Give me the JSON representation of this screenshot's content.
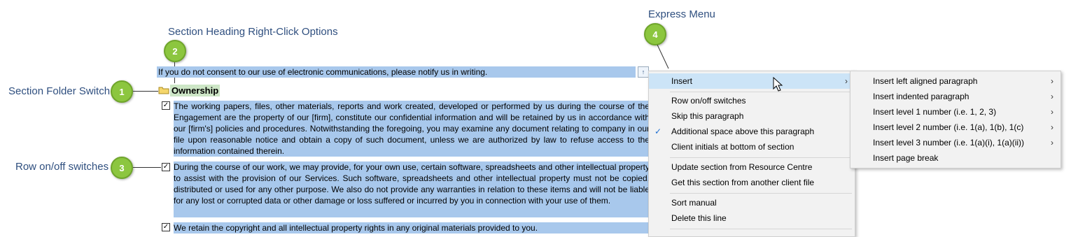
{
  "annotations": {
    "express_menu": "Express Menu",
    "section_heading": "Section Heading Right-Click Options",
    "section_folder": "Section Folder Switch",
    "row_switches": "Row on/off switches"
  },
  "callouts": [
    "1",
    "2",
    "3",
    "4"
  ],
  "document": {
    "top_line": "If you do not consent to our use of electronic communications, please notify us in writing.",
    "section_title": "Ownership",
    "paragraphs": [
      "The working papers, files, other materials, reports and work created, developed or performed by us during the course of the Engagement are the property of our [firm], constitute our confidential information and will be retained by us in accordance with our [firm's] policies and procedures. Notwithstanding the foregoing, you may examine any document relating to company in our file upon reasonable notice and obtain a copy of such document, unless we are authorized by law to refuse access to the information contained therein.",
      "During the course of our work, we may provide, for your own use, certain software, spreadsheets and other intellectual property to assist with the provision of our Services. Such software, spreadsheets and other intellectual property must not be copied, distributed or used for any other purpose. We also do not provide any warranties in relation to these items and will not be liable for any lost or corrupted data or other damage or loss suffered or incurred by you in connection with your use of them.",
      "We retain the copyright and all intellectual property rights in any original materials provided to you."
    ]
  },
  "context_menu": {
    "items": [
      {
        "label": "Insert",
        "submenu": true,
        "highlighted": true
      },
      {
        "label": "Row on/off switches"
      },
      {
        "label": "Skip this paragraph"
      },
      {
        "label": "Additional space above this paragraph",
        "checked": true
      },
      {
        "label": "Client initials at bottom of section"
      },
      {
        "label": "Update section from Resource Centre"
      },
      {
        "label": "Get this section from another client file"
      },
      {
        "label": "Sort manual"
      },
      {
        "label": "Delete this line"
      }
    ]
  },
  "submenu": {
    "items": [
      {
        "label": "Insert left aligned paragraph",
        "submenu": true
      },
      {
        "label": "Insert indented paragraph",
        "submenu": true
      },
      {
        "label": "Insert level 1 number (i.e. 1, 2, 3)",
        "submenu": true
      },
      {
        "label": "Insert level 2 number (i.e. 1(a), 1(b), 1(c)",
        "submenu": true
      },
      {
        "label": "Insert level 3 number (i.e. 1(a)(i), 1(a)(ii))",
        "submenu": true
      },
      {
        "label": "Insert page break"
      }
    ]
  },
  "colors": {
    "highlight": "#a8c8ec",
    "callout": "#8cc63f",
    "menu_hover": "#cce4f7",
    "annotation": "#2f4f7f"
  }
}
